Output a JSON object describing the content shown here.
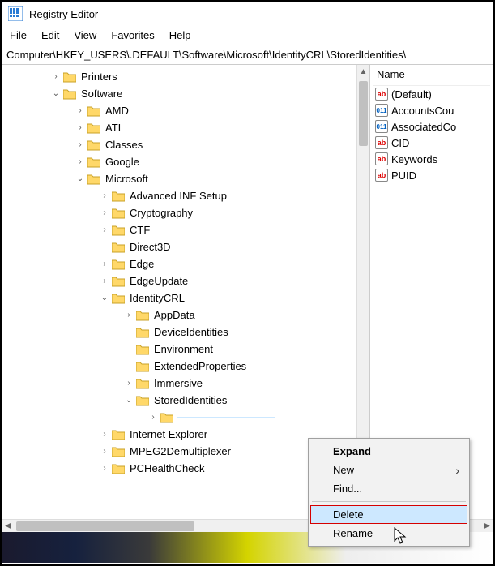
{
  "app": {
    "title": "Registry Editor"
  },
  "menu": {
    "file": "File",
    "edit": "Edit",
    "view": "View",
    "favorites": "Favorites",
    "help": "Help"
  },
  "address": "Computer\\HKEY_USERS\\.DEFAULT\\Software\\Microsoft\\IdentityCRL\\StoredIdentities\\",
  "tree": {
    "printers": "Printers",
    "software": "Software",
    "amd": "AMD",
    "ati": "ATI",
    "classes": "Classes",
    "google": "Google",
    "microsoft": "Microsoft",
    "adv_inf": "Advanced INF Setup",
    "cryptography": "Cryptography",
    "ctf": "CTF",
    "direct3d": "Direct3D",
    "edge": "Edge",
    "edgeupdate": "EdgeUpdate",
    "identitycrl": "IdentityCRL",
    "appdata": "AppData",
    "deviceidentities": "DeviceIdentities",
    "environment": "Environment",
    "extendedproperties": "ExtendedProperties",
    "immersive": "Immersive",
    "storedidentities": "StoredIdentities",
    "selected_blank": "",
    "internetexplorer": "Internet Explorer",
    "mpeg2": "MPEG2Demultiplexer",
    "pchealth": "PCHealthCheck"
  },
  "values": {
    "header": "Name",
    "default": "(Default)",
    "accountscount": "AccountsCou",
    "associatedcount": "AssociatedCo",
    "cid": "CID",
    "keywords": "Keywords",
    "puid": "PUID"
  },
  "contextmenu": {
    "expand": "Expand",
    "new": "New",
    "find": "Find...",
    "delete": "Delete",
    "rename": "Rename"
  }
}
